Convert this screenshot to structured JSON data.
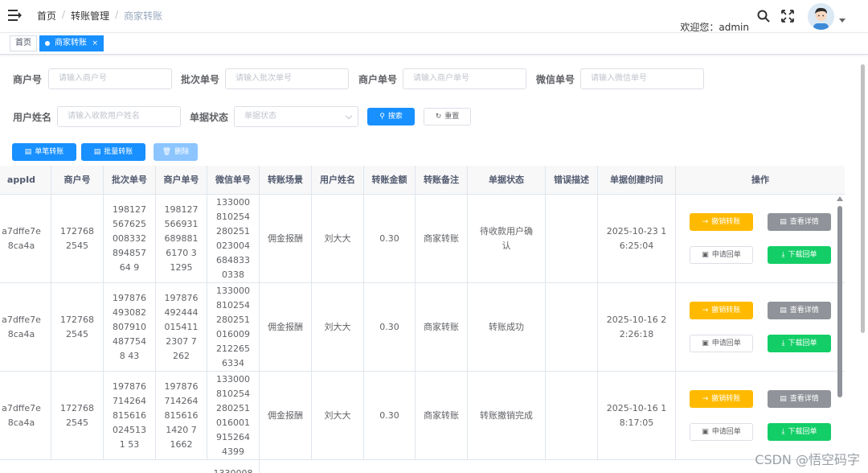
{
  "breadcrumb": [
    "首页",
    "转账管理",
    "商家转账"
  ],
  "header": {
    "welcome": "欢迎您：admin"
  },
  "tags": {
    "home": "首页",
    "active": "商家转账",
    "close": "×"
  },
  "filters": [
    {
      "label": "商户号",
      "placeholder": "请输入商户号"
    },
    {
      "label": "批次单号",
      "placeholder": "请输入批次单号"
    },
    {
      "label": "商户单号",
      "placeholder": "请输入商户单号"
    },
    {
      "label": "微信单号",
      "placeholder": "请输入微信单号"
    },
    {
      "label": "用户姓名",
      "placeholder": "请输入收款用户姓名"
    },
    {
      "label": "单据状态",
      "placeholder": "单据状态"
    }
  ],
  "buttons": {
    "search": "搜索",
    "reset": "重置",
    "single": "单笔转账",
    "batch": "批量转账",
    "delete": "删除"
  },
  "table": {
    "columns": [
      "appId",
      "商户号",
      "批次单号",
      "商户单号",
      "微信单号",
      "转账场景",
      "用户姓名",
      "转账金额",
      "转账备注",
      "单据状态",
      "错误描述",
      "单据创建时间",
      "操作"
    ],
    "actions": {
      "revoke": "撤销转账",
      "detail": "查看详情",
      "apply": "申请回单",
      "download": "下载回单"
    },
    "rows": [
      {
        "appid": "a7dffe7e8ca4a",
        "mchid": "1727682545",
        "batch": "19812756762500833289485764 9",
        "outno": "1981275669316898816170 31295",
        "wxno": "1330008102542802510230046848330338",
        "scene": "佣金报酬",
        "name": "刘大大",
        "amount": "0.30",
        "remark": "商家转账",
        "status": "待收款用户确认",
        "error": "",
        "created": "2025-10-23 16:25:04"
      },
      {
        "appid": "a7dffe7e8ca4a",
        "mchid": "1727682545",
        "batch": "1978764930828079104877548 43",
        "outno": "1978764924440154112307 7262",
        "wxno": "1330008102542802510160092122656334",
        "scene": "佣金报酬",
        "name": "刘大大",
        "amount": "0.30",
        "remark": "商家转账",
        "status": "转账成功",
        "error": "",
        "created": "2025-10-16 22:26:18"
      },
      {
        "appid": "a7dffe7e8ca4a",
        "mchid": "1727682545",
        "batch": "1978767142648156160245131 53",
        "outno": "1978767142648156161420 71662",
        "wxno": "1330008102542802510160019152644399",
        "scene": "佣金报酬",
        "name": "刘大大",
        "amount": "0.30",
        "remark": "商家转账",
        "status": "转账撤销完成",
        "error": "",
        "created": "2025-10-16 18:17:05"
      }
    ],
    "partial_row_wxno": "1330008"
  },
  "watermark": "CSDN @悟空码字"
}
